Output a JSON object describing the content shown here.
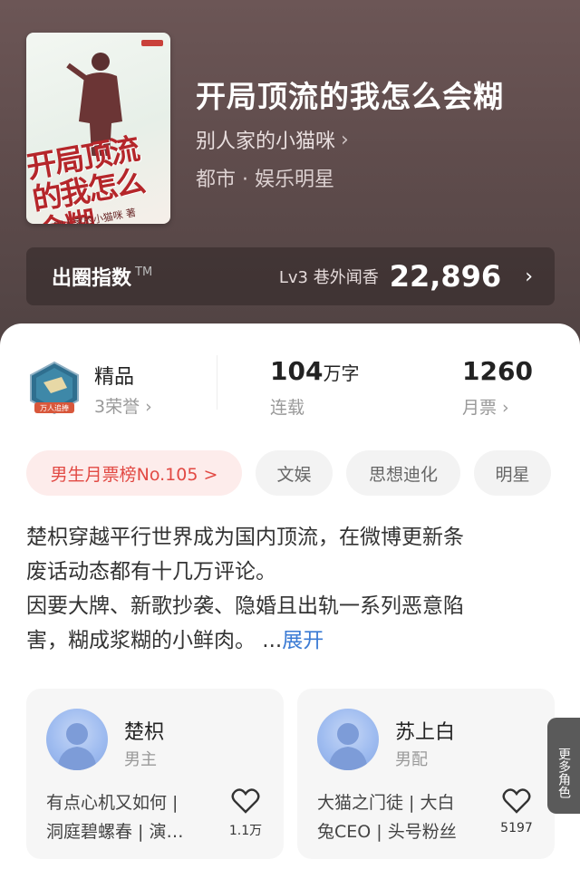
{
  "book": {
    "title": "开局顶流的我怎么会糊",
    "author": "别人家的小猫咪",
    "author_chevron": "›",
    "category": "都市 · 娱乐明星",
    "cover_title": "开局顶流的我怎么会糊",
    "cover_author": "别人家的小猫咪 著"
  },
  "index": {
    "label": "出圈指数",
    "tm": "TM",
    "level": "Lv3 巷外闻香",
    "value": "22,896",
    "chevron": "›"
  },
  "stats": {
    "honor_title": "精品",
    "honor_sub": "3荣誉 ›",
    "badge_text": "万人追捧",
    "word_count_num": "104",
    "word_count_unit": "万字",
    "word_status": "连载",
    "monthly_ticket_num": "1260",
    "monthly_ticket_label": "月票 ›"
  },
  "tags": {
    "rank": "男生月票榜No.105 >",
    "items": [
      "文娱",
      "思想迪化",
      "明星"
    ]
  },
  "description": {
    "text": "楚枳穿越平行世界成为国内顶流，在微博更新条废话动态都有十几万评论。因要大牌、新歌抄袭、隐婚且出轨一系列恶意陷害，糊成浆糊的小鲜肉。 ...",
    "line1": "楚枳穿越平行世界成为国内顶流，在微博更新条",
    "line2": "废话动态都有十几万评论。",
    "line3": "因要大牌、新歌抄袭、隐婚且出轨一系列恶意陷",
    "line4": "害，糊成浆糊的小鲜肉。 ...",
    "expand": "展开"
  },
  "characters": [
    {
      "name": "楚枳",
      "role": "男主",
      "desc_line1": "有点心机又如何 |",
      "desc_line2": "洞庭碧螺春 | 演…",
      "likes": "1.1万"
    },
    {
      "name": "苏上白",
      "role": "男配",
      "desc_line1": "大猫之门徒 | 大白",
      "desc_line2": "兔CEO | 头号粉丝",
      "likes": "5197"
    }
  ],
  "more_roles": "更多角色",
  "colors": {
    "hero_bg": "#5f4c4c",
    "rank_chip_bg": "#fdeceb",
    "rank_chip_text": "#e24a44",
    "link": "#3b7bd4"
  }
}
